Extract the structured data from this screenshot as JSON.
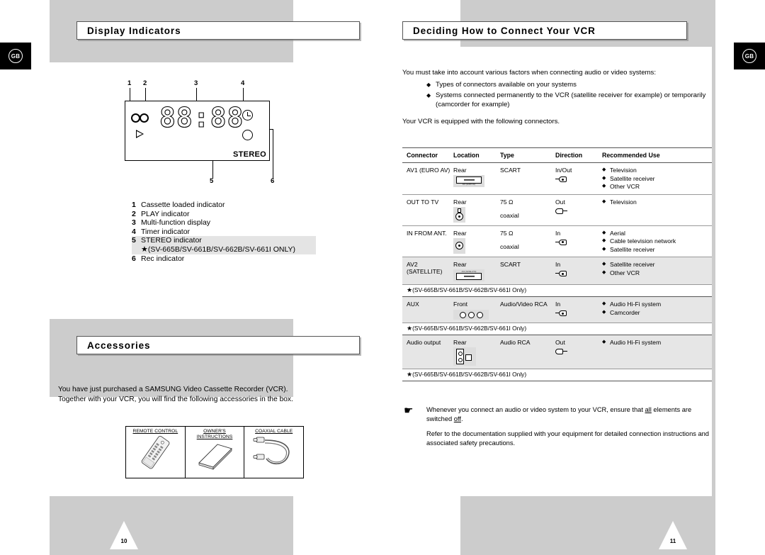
{
  "page": {
    "locale_badge": "GB",
    "left_page_number": "10",
    "right_page_number": "11"
  },
  "left": {
    "section_display": {
      "title": "Display Indicators",
      "diagram": {
        "callouts": [
          "1",
          "2",
          "3",
          "4",
          "5",
          "6"
        ],
        "segment_display": "88:88",
        "stereo_label": "STEREO"
      },
      "legend": [
        {
          "n": "1",
          "label": "Cassette loaded indicator"
        },
        {
          "n": "2",
          "label": "PLAY indicator"
        },
        {
          "n": "3",
          "label": "Multi-function display"
        },
        {
          "n": "4",
          "label": "Timer indicator"
        },
        {
          "n": "5",
          "label": "STEREO indicator"
        },
        {
          "n": "6",
          "label": "Rec indicator"
        }
      ],
      "legend_note": "(SV-665B/SV-661B/SV-662B/SV-661I ONLY)",
      "legend_note_star": "★"
    },
    "section_accessories": {
      "title": "Accessories",
      "paragraph_line1": "You have just purchased a SAMSUNG Video Cassette Recorder (VCR).",
      "paragraph_line2": "Together with your VCR, you will find the following accessories in the box.",
      "items": [
        {
          "caption": "REMOTE CONTROL"
        },
        {
          "caption_line1": "OWNER'S",
          "caption_line2": "INSTRUCTIONS"
        },
        {
          "caption": "COAXIAL CABLE"
        }
      ]
    }
  },
  "right": {
    "title": "Deciding How to Connect Your VCR",
    "intro_lead": "You must take into account various factors when connecting audio or video systems:",
    "intro_bullets": [
      "Types of connectors available on your systems",
      "Systems connected permanently to the VCR (satellite receiver for example) or temporarily (camcorder for example)"
    ],
    "intro_tail": "Your VCR is equipped with the following connectors.",
    "table": {
      "headers": [
        "Connector",
        "Location",
        "Type",
        "Direction",
        "Recommended Use"
      ],
      "rows": [
        {
          "connector": "AV1 (EURO AV)",
          "location": "Rear",
          "location_icon": "scart-connector-icon",
          "scart_label": "AV1 (EURO AV)",
          "type": "SCART",
          "type_sub": "",
          "direction": "In/Out",
          "direction_icon": "arrow-in-out-icon",
          "uses": [
            "Television",
            "Satellite receiver",
            "Other VCR"
          ],
          "note": "",
          "shaded": false
        },
        {
          "connector": "OUT TO TV",
          "location": "Rear",
          "location_icon": "coaxial-connector-icon",
          "type": "75 Ω",
          "type_sub": "coaxial",
          "direction": "Out",
          "direction_icon": "arrow-out-icon",
          "uses": [
            "Television"
          ],
          "note": "",
          "shaded": false
        },
        {
          "connector": "IN FROM ANT.",
          "location": "Rear",
          "location_icon": "coaxial-connector-icon",
          "type": "75 Ω",
          "type_sub": "coaxial",
          "direction": "In",
          "direction_icon": "arrow-in-icon",
          "uses": [
            "Aerial",
            "Cable television network",
            "Satellite receiver"
          ],
          "note": "",
          "shaded": false
        },
        {
          "connector": "AV2",
          "connector_line2": "(SATELLITE)",
          "location": "Rear",
          "location_icon": "scart-connector-icon",
          "scart_label": "AV2 (SATELLITE)",
          "type": "SCART",
          "type_sub": "",
          "direction": "In",
          "direction_icon": "arrow-in-icon",
          "uses": [
            "Satellite receiver",
            "Other VCR"
          ],
          "note": "(SV-665B/SV-661B/SV-662B/SV-661I Only)",
          "note_star": "★",
          "shaded": true
        },
        {
          "connector": "AUX",
          "location": "Front",
          "location_icon": "rca-triple-connector-icon",
          "type": "Audio/Video RCA",
          "type_sub": "",
          "direction": "In",
          "direction_icon": "arrow-in-icon",
          "uses": [
            "Audio Hi-Fi system",
            "Camcorder"
          ],
          "note": "(SV-665B/SV-661B/SV-662B/SV-661I Only)",
          "note_star": "★",
          "shaded": true
        },
        {
          "connector": "Audio output",
          "location": "Rear",
          "location_icon": "audio-output-connector-icon",
          "type": "Audio RCA",
          "type_sub": "",
          "direction": "Out",
          "direction_icon": "arrow-out-icon",
          "uses": [
            "Audio Hi-Fi system"
          ],
          "note": "(SV-665B/SV-661B/SV-662B/SV-661I Only)",
          "note_star": "★",
          "shaded": true
        }
      ]
    },
    "note": {
      "icon": "pointing-hand-icon",
      "line1_a": "Whenever you connect an audio or video system to your VCR, ensure that ",
      "line1_u1": "all",
      "line1_b": " elements are switched ",
      "line1_u2": "off",
      "line1_c": ".",
      "line2": "Refer to the documentation supplied with your equipment for detailed connection instructions and associated safety precautions."
    }
  },
  "colors": {
    "page_background": "#cccccc",
    "content_background": "#ffffff",
    "badge_background": "#000000",
    "highlight": "#e4e4e4",
    "table_shade": "#e6e6e6"
  }
}
